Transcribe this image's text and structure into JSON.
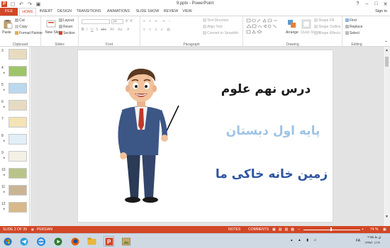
{
  "window": {
    "title": "9.pptx - PowerPoint",
    "controls": [
      "?",
      "–",
      "□",
      "✕"
    ]
  },
  "tabs": [
    "FILE",
    "HOME",
    "INSERT",
    "DESIGN",
    "TRANSITIONS",
    "ANIMATIONS",
    "SLIDE SHOW",
    "REVIEW",
    "VIEW"
  ],
  "signin": "Sign in",
  "ribbon": {
    "clipboard": {
      "paste": "Paste",
      "cut": "Cut",
      "copy": "Copy",
      "format_painter": "Format Painter",
      "label": "Clipboard"
    },
    "slides": {
      "new_slide": "New Slide",
      "layout": "Layout",
      "reset": "Reset",
      "section": "Section",
      "label": "Slides"
    },
    "font": {
      "size": "24",
      "label": "Font"
    },
    "paragraph": {
      "text_direction": "Text Direction",
      "align_text": "Align Text",
      "smartart": "Convert to SmartArt",
      "label": "Paragraph"
    },
    "drawing": {
      "arrange": "Arrange",
      "quick_styles": "Quick Styles",
      "shape_fill": "Shape Fill",
      "shape_outline": "Shape Outline",
      "shape_effects": "Shape Effects",
      "label": "Drawing"
    },
    "editing": {
      "find": "Find",
      "replace": "Replace",
      "select": "Select",
      "label": "Editing"
    }
  },
  "thumbnails": [
    {
      "num": "3"
    },
    {
      "num": "4"
    },
    {
      "num": "5"
    },
    {
      "num": "6"
    },
    {
      "num": "7"
    },
    {
      "num": "8"
    },
    {
      "num": "9"
    },
    {
      "num": "10"
    },
    {
      "num": "11"
    },
    {
      "num": "12"
    }
  ],
  "slide": {
    "line1": "درس نهم علوم",
    "line2": "پایه اول دبستان",
    "line3": "زمین خانه خاکی ما"
  },
  "status": {
    "slide_info": "SLIDE 2 OF 39",
    "language": "PERSIAN",
    "notes": "NOTES",
    "comments": "COMMENTS",
    "zoom": "74 %"
  },
  "taskbar": {
    "lang": "FA",
    "time": "۰۲:۵۵ ق.ظ",
    "date": "۱۳۹۷/۰۱/۱۴"
  },
  "colors": {
    "accent": "#d24726",
    "title_dark": "#1a1a1a",
    "title_light": "#9dc3e6",
    "title_blue": "#2e54a0"
  }
}
